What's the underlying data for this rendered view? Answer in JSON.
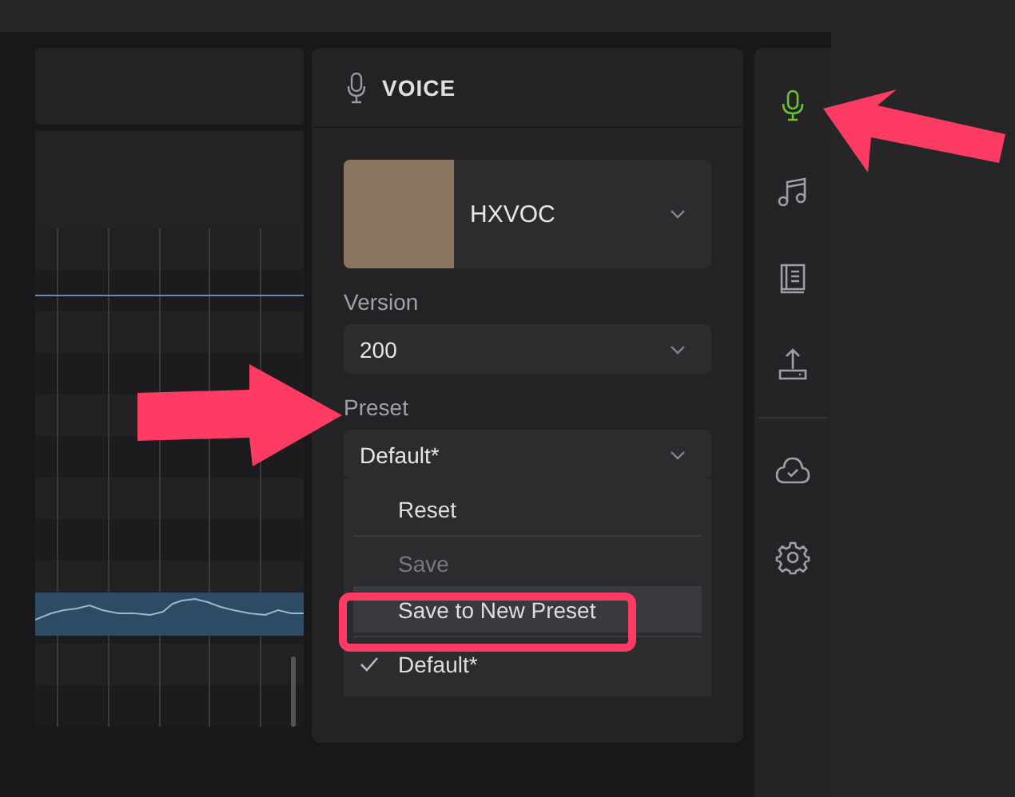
{
  "voice_panel": {
    "title": "VOICE",
    "voice": {
      "name": "HXVOC"
    },
    "version": {
      "label": "Version",
      "value": "200"
    },
    "preset": {
      "label": "Preset",
      "value": "Default*",
      "expanded": true,
      "menu": [
        {
          "kind": "item",
          "label": "Reset",
          "disabled": false,
          "highlighted": false,
          "checked": false
        },
        {
          "kind": "divider"
        },
        {
          "kind": "item",
          "label": "Save",
          "disabled": true,
          "highlighted": false,
          "checked": false
        },
        {
          "kind": "item",
          "label": "Save to New Preset",
          "disabled": false,
          "highlighted": true,
          "checked": false
        },
        {
          "kind": "divider"
        },
        {
          "kind": "item",
          "label": "Default*",
          "disabled": false,
          "highlighted": false,
          "checked": true
        }
      ]
    }
  },
  "sidebar": {
    "top": [
      {
        "kind": "mic",
        "selected": true
      },
      {
        "kind": "music",
        "selected": false
      },
      {
        "kind": "book",
        "selected": false
      },
      {
        "kind": "upload",
        "selected": false
      }
    ],
    "bottom": [
      {
        "kind": "cloud",
        "selected": false
      },
      {
        "kind": "gear",
        "selected": false
      }
    ]
  }
}
